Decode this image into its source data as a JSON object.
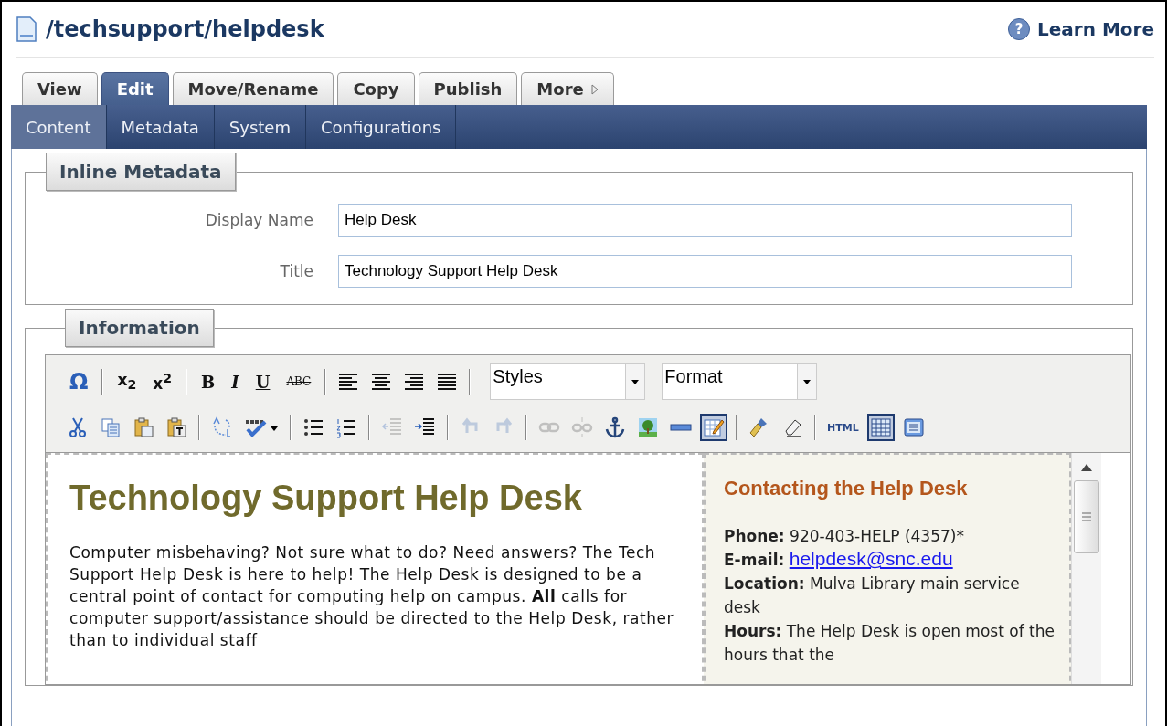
{
  "header": {
    "title": "/techsupport/helpdesk",
    "help_icon": "?",
    "help_link": "Learn More"
  },
  "tabs": [
    {
      "label": "View",
      "selected": false
    },
    {
      "label": "Edit",
      "selected": true
    },
    {
      "label": "Move/Rename",
      "selected": false
    },
    {
      "label": "Copy",
      "selected": false
    },
    {
      "label": "Publish",
      "selected": false
    },
    {
      "label": "More",
      "selected": false,
      "kind": "menu"
    }
  ],
  "subtabs": [
    {
      "label": "Content",
      "selected": true
    },
    {
      "label": "Metadata",
      "selected": false
    },
    {
      "label": "System",
      "selected": false
    },
    {
      "label": "Configurations",
      "selected": false
    }
  ],
  "inline_metadata": {
    "legend": "Inline Metadata",
    "fields": [
      {
        "label": "Display Name",
        "value": "Help Desk"
      },
      {
        "label": "Title",
        "value": "Technology Support Help Desk"
      }
    ]
  },
  "information": {
    "legend": "Information",
    "toolbar": [
      [
        {
          "kind": "omega",
          "label": "Ω"
        },
        {
          "kind": "separator"
        },
        {
          "kind": "sub",
          "label": "x$_{2}$"
        },
        {
          "kind": "sup",
          "label": "x$^{2}$"
        },
        {
          "kind": "separator"
        },
        {
          "kind": "bold",
          "label": "B"
        },
        {
          "kind": "italic",
          "label": "I"
        },
        {
          "kind": "underline",
          "label": "U"
        },
        {
          "kind": "strike",
          "label": "ABC"
        },
        {
          "kind": "separator"
        },
        {
          "kind": "align-left"
        },
        {
          "kind": "align-center"
        },
        {
          "kind": "align-right"
        },
        {
          "kind": "justify"
        },
        {
          "kind": "separator"
        },
        {
          "kind": "dropdown",
          "label": "Styles"
        },
        {
          "kind": "dropdown",
          "label": "Format"
        }
      ],
      [
        {
          "kind": "cut",
          "disabled": false,
          "selected": false
        },
        {
          "kind": "copy",
          "disabled": false,
          "selected": false
        },
        {
          "kind": "paste",
          "disabled": false,
          "selected": false
        },
        {
          "kind": "paste-text",
          "disabled": false,
          "selected": false
        },
        {
          "kind": "separator"
        },
        {
          "kind": "replace",
          "disabled": false,
          "selected": false
        },
        {
          "kind": "spellcheck",
          "disabled": false,
          "selected": false
        },
        {
          "kind": "separator"
        },
        {
          "kind": "bullets",
          "disabled": false,
          "selected": false
        },
        {
          "kind": "numbers",
          "disabled": false,
          "selected": false
        },
        {
          "kind": "separator"
        },
        {
          "kind": "outdent",
          "disabled": true,
          "selected": false
        },
        {
          "kind": "indent",
          "disabled": false,
          "selected": false
        },
        {
          "kind": "separator"
        },
        {
          "kind": "undo",
          "disabled": true,
          "selected": false
        },
        {
          "kind": "redo",
          "disabled": true,
          "selected": false
        },
        {
          "kind": "separator"
        },
        {
          "kind": "link",
          "disabled": true,
          "selected": false
        },
        {
          "kind": "unlink",
          "disabled": true,
          "selected": false
        },
        {
          "kind": "anchor",
          "disabled": false,
          "selected": false
        },
        {
          "kind": "image",
          "disabled": false,
          "selected": false
        },
        {
          "kind": "rule",
          "disabled": false,
          "selected": false
        },
        {
          "kind": "edit-table",
          "disabled": false,
          "selected": true
        },
        {
          "kind": "separator"
        },
        {
          "kind": "brush",
          "disabled": false,
          "selected": false
        },
        {
          "kind": "eraser",
          "disabled": false,
          "selected": false
        },
        {
          "kind": "separator"
        },
        {
          "kind": "html",
          "label": "HTML",
          "disabled": false,
          "selected": false
        },
        {
          "kind": "table",
          "disabled": false,
          "selected": true
        },
        {
          "kind": "preview",
          "disabled": false,
          "selected": false
        }
      ]
    ],
    "document": {
      "heading": "Technology Support Help Desk",
      "paragraph": "Computer misbehaving? Not sure what to do? Need answers? The Tech Support Help Desk is here to help! The Help Desk is designed to be a central point of contact for computing help on campus. **All** calls for computer support/assistance should be directed to the Help Desk, rather than to individual staff",
      "sidebar": {
        "heading": "Contacting the Help Desk",
        "lines": [
          {
            "kind": "text",
            "text": "**Phone:** 920-403-HELP (4357)*"
          },
          {
            "kind": "link",
            "label": "E-mail:",
            "text": "helpdesk@snc.edu"
          },
          {
            "kind": "text",
            "text": "**Location:** Mulva Library main service desk"
          },
          {
            "kind": "text",
            "text": "**Hours:** The Help Desk is open most of the hours that the"
          }
        ]
      }
    }
  }
}
